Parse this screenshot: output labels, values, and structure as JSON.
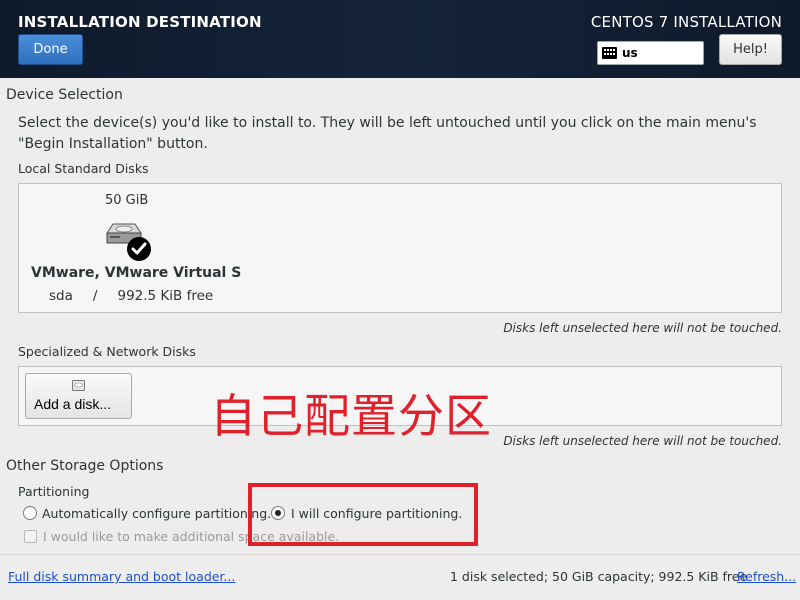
{
  "header": {
    "spoke_title": "INSTALLATION DESTINATION",
    "done_label": "Done",
    "product_title": "CENTOS 7 INSTALLATION",
    "keyboard_layout": "us",
    "help_label": "Help!"
  },
  "device_selection": {
    "heading": "Device Selection",
    "intro_line1": "Select the device(s) you'd like to install to.  They will be left untouched until you click on the main menu's",
    "intro_line2": "\"Begin Installation\" button.",
    "local_heading": "Local Standard Disks",
    "disk": {
      "size": "50 GiB",
      "name": "VMware, VMware Virtual S",
      "device": "sda",
      "separator": "/",
      "free": "992.5 KiB free",
      "selected": true
    },
    "local_hint": "Disks left unselected here will not be touched.",
    "specialized_heading": "Specialized & Network Disks",
    "add_disk_label": "Add a disk...",
    "specialized_hint": "Disks left unselected here will not be touched."
  },
  "annotation": {
    "text": "自己配置分区",
    "color": "#e0202a"
  },
  "other_storage": {
    "heading": "Other Storage Options",
    "partitioning_heading": "Partitioning",
    "auto_label": "Automatically configure partitioning.",
    "manual_label": "I will configure partitioning.",
    "manual_selected": true,
    "extra_space_label": "I would like to make additional space available."
  },
  "footer": {
    "summary_link": "Full disk summary and boot loader...",
    "summary_text": "1 disk selected; 50 GiB capacity; 992.5 KiB free",
    "refresh_link": "Refresh..."
  },
  "colors": {
    "header_bg": "#0e1a2b",
    "done_button": "#2f6fc0",
    "link": "#1c4fd0",
    "annotation_red": "#e0202a"
  }
}
